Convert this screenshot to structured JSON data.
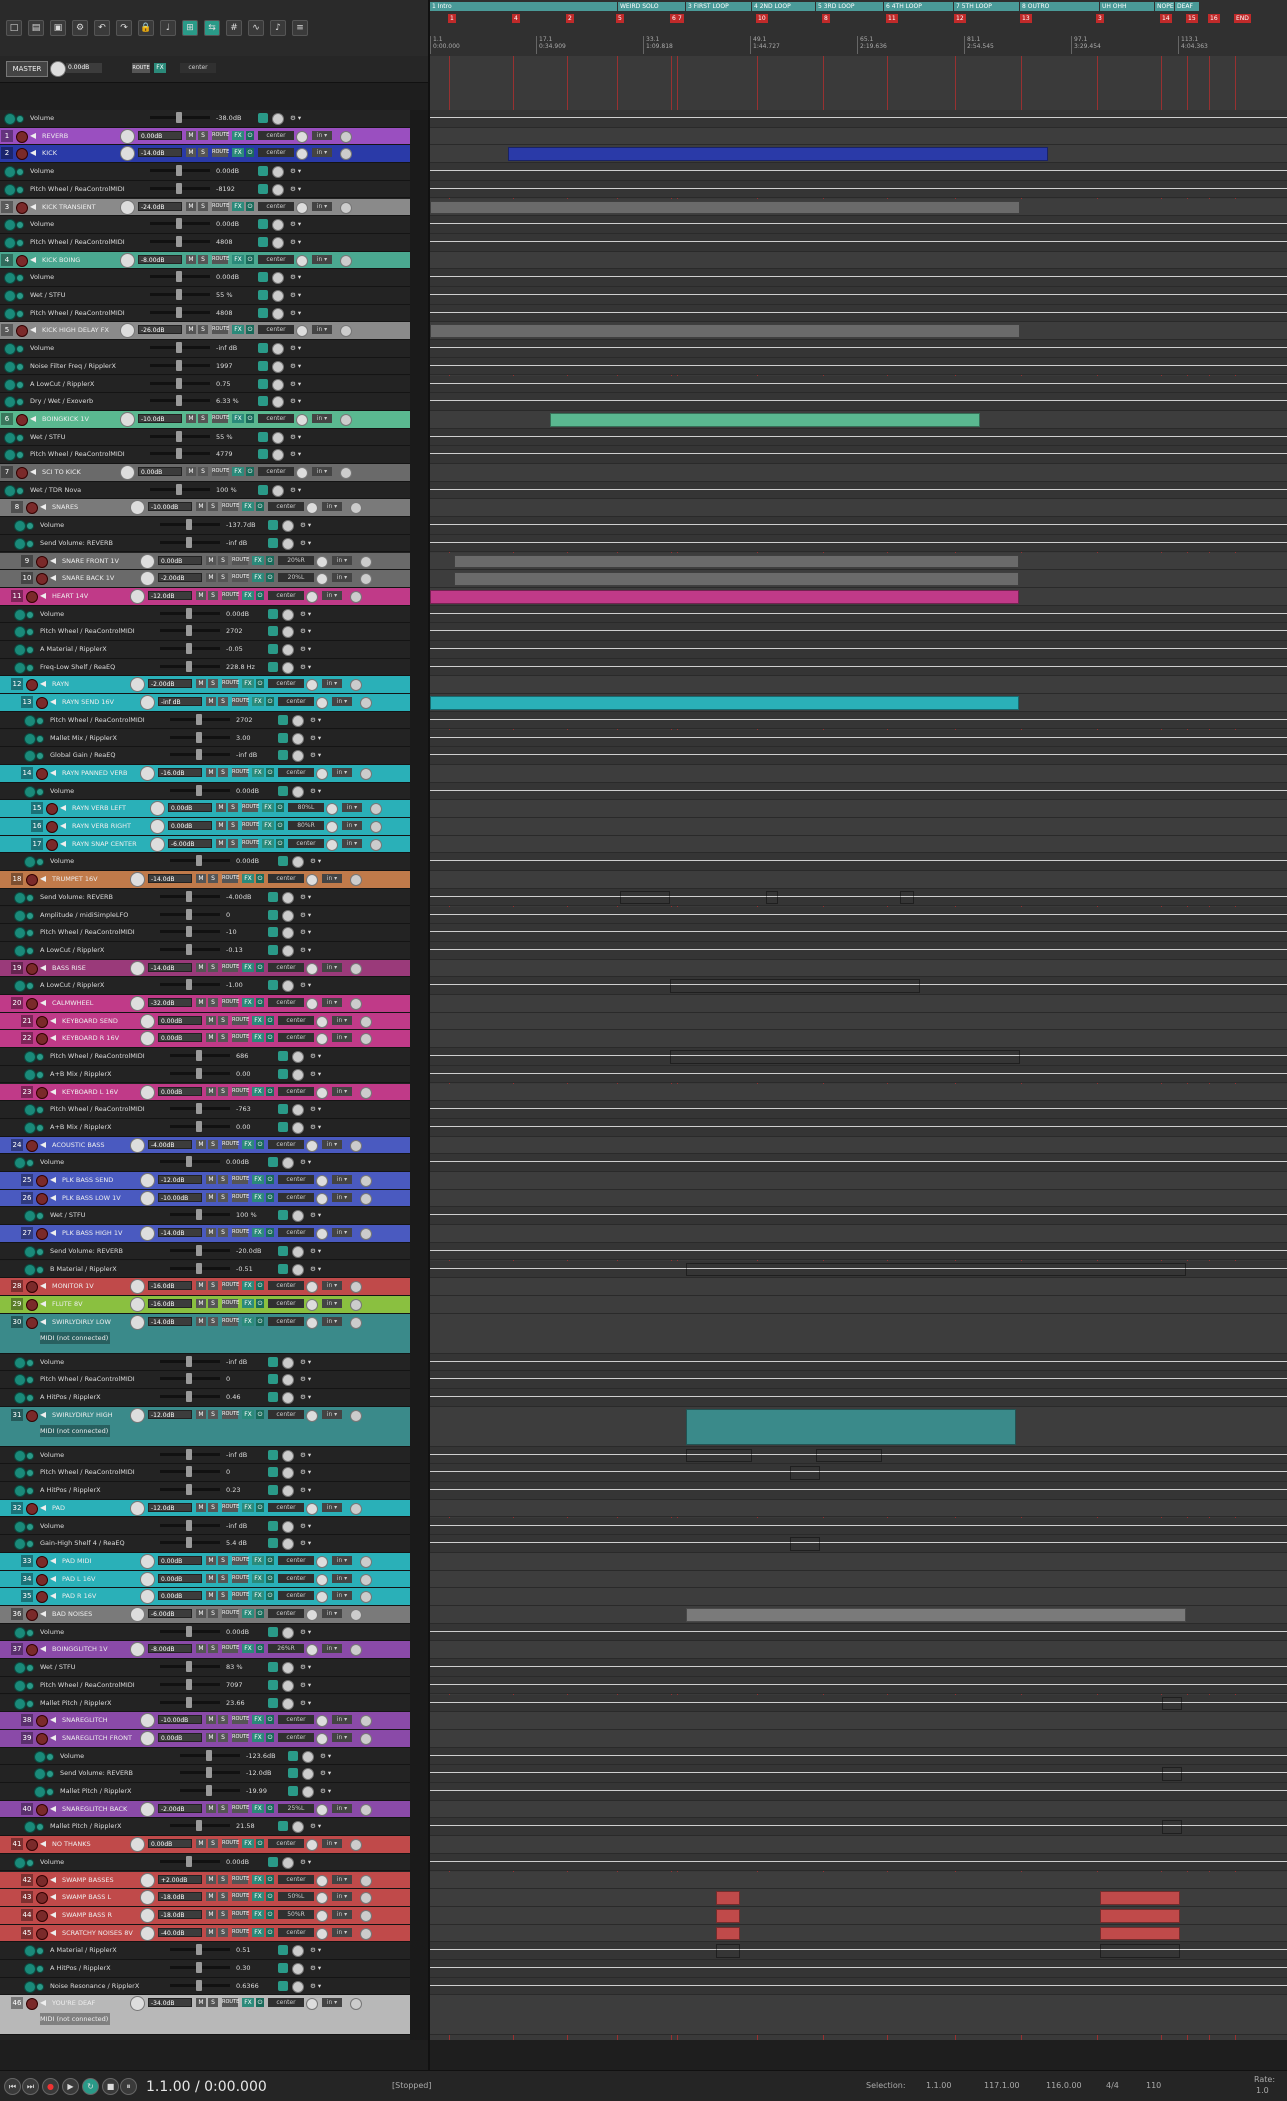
{
  "master": {
    "label": "MASTER",
    "volume": "0.00dB",
    "pan": "center",
    "route": "ROUTE",
    "fx": "FX"
  },
  "master_env": {
    "name": "Volume",
    "value": "-38.0dB"
  },
  "regions": [
    {
      "label": "1 Intro"
    },
    {
      "label": "WEIRD SOLO"
    },
    {
      "label": "3 FIRST LOOP"
    },
    {
      "label": "4 2ND LOOP"
    },
    {
      "label": "5 3RD LOOP"
    },
    {
      "label": "6 4TH LOOP"
    },
    {
      "label": "7 5TH LOOP"
    },
    {
      "label": "8 OUTRO"
    },
    {
      "label": "UH OHH"
    },
    {
      "label": "NOPE"
    },
    {
      "label": "DEAF"
    }
  ],
  "markers": [
    {
      "label": "1"
    },
    {
      "label": "4"
    },
    {
      "label": "2"
    },
    {
      "label": "5"
    },
    {
      "label": "6"
    },
    {
      "label": "7"
    },
    {
      "label": "10"
    },
    {
      "label": "8"
    },
    {
      "label": "11"
    },
    {
      "label": "12"
    },
    {
      "label": "13"
    },
    {
      "label": "3"
    },
    {
      "label": "14"
    },
    {
      "label": "15"
    },
    {
      "label": "16"
    },
    {
      "label": "END"
    }
  ],
  "ruler_ticks": [
    {
      "bar": "1.1",
      "time": "0:00.000"
    },
    {
      "bar": "17.1",
      "time": "0:34.909"
    },
    {
      "bar": "33.1",
      "time": "1:09.818"
    },
    {
      "bar": "49.1",
      "time": "1:44.727"
    },
    {
      "bar": "65.1",
      "time": "2:19.636"
    },
    {
      "bar": "81.1",
      "time": "2:54.545"
    },
    {
      "bar": "97.1",
      "time": "3:29.454"
    },
    {
      "bar": "113.1",
      "time": "4:04.363"
    }
  ],
  "tracks": [
    {
      "kind": "env",
      "indent": 0,
      "name": "Volume",
      "value": "-38.0dB"
    },
    {
      "kind": "track",
      "num": "1",
      "indent": 0,
      "name": "REVERB",
      "color": "#9a4fc0",
      "vol": "0.00dB",
      "pan": "center"
    },
    {
      "kind": "track",
      "num": "2",
      "indent": 0,
      "name": "KICK",
      "color": "#2a3aa8",
      "vol": "-14.0dB",
      "pan": "center"
    },
    {
      "kind": "env",
      "indent": 0,
      "name": "Volume",
      "value": "0.00dB"
    },
    {
      "kind": "env",
      "indent": 0,
      "name": "Pitch Wheel / ReaControlMIDI",
      "value": "-8192"
    },
    {
      "kind": "track",
      "num": "3",
      "indent": 0,
      "name": "KICK TRANSIENT",
      "color": "#8a8a8a",
      "vol": "-24.0dB",
      "pan": "center"
    },
    {
      "kind": "env",
      "indent": 0,
      "name": "Volume",
      "value": "0.00dB"
    },
    {
      "kind": "env",
      "indent": 0,
      "name": "Pitch Wheel / ReaControlMIDI",
      "value": "4808"
    },
    {
      "kind": "track",
      "num": "4",
      "indent": 0,
      "name": "KICK BOING",
      "color": "#4aa890",
      "vol": "-8.00dB",
      "pan": "center"
    },
    {
      "kind": "env",
      "indent": 0,
      "name": "Volume",
      "value": "0.00dB"
    },
    {
      "kind": "env",
      "indent": 0,
      "name": "Wet / STFU",
      "value": "55 %"
    },
    {
      "kind": "env",
      "indent": 0,
      "name": "Pitch Wheel / ReaControlMIDI",
      "value": "4808"
    },
    {
      "kind": "track",
      "num": "5",
      "indent": 0,
      "name": "KICK HIGH DELAY FX",
      "color": "#8a8a8a",
      "vol": "-26.0dB",
      "pan": "center"
    },
    {
      "kind": "env",
      "indent": 0,
      "name": "Volume",
      "value": "-inf dB"
    },
    {
      "kind": "env",
      "indent": 0,
      "name": "Noise Filter Freq / RipplerX",
      "value": "1997"
    },
    {
      "kind": "env",
      "indent": 0,
      "name": "A LowCut / RipplerX",
      "value": "0.75"
    },
    {
      "kind": "env",
      "indent": 0,
      "name": "Dry / Wet / Exoverb",
      "value": "6.33 %"
    },
    {
      "kind": "track",
      "num": "6",
      "indent": 0,
      "name": "BOINGKICK 1V",
      "color": "#5ab890",
      "vol": "-10.0dB",
      "pan": "center"
    },
    {
      "kind": "env",
      "indent": 0,
      "name": "Wet / STFU",
      "value": "55 %"
    },
    {
      "kind": "env",
      "indent": 0,
      "name": "Pitch Wheel / ReaControlMIDI",
      "value": "4779"
    },
    {
      "kind": "track",
      "num": "7",
      "indent": 0,
      "name": "SCI TO KICK",
      "color": "#6a6a6a",
      "vol": "0.00dB",
      "pan": "center"
    },
    {
      "kind": "env",
      "indent": 0,
      "name": "Wet / TDR Nova",
      "value": "100 %"
    },
    {
      "kind": "track",
      "num": "8",
      "indent": 1,
      "name": "SNARES",
      "color": "#7a7a7a",
      "vol": "-10.00dB",
      "pan": "center"
    },
    {
      "kind": "env",
      "indent": 1,
      "name": "Volume",
      "value": "-137.7dB"
    },
    {
      "kind": "env",
      "indent": 1,
      "name": "Send Volume: REVERB",
      "value": "-inf dB"
    },
    {
      "kind": "track",
      "num": "9",
      "indent": 2,
      "name": "SNARE FRONT 1V",
      "color": "#6a6a6a",
      "vol": "0.00dB",
      "pan": "20%R"
    },
    {
      "kind": "track",
      "num": "10",
      "indent": 2,
      "name": "SNARE BACK 1V",
      "color": "#6a6a6a",
      "vol": "-2.00dB",
      "pan": "20%L"
    },
    {
      "kind": "track",
      "num": "11",
      "indent": 1,
      "name": "HEART 14V",
      "color": "#c03a88",
      "vol": "-12.0dB",
      "pan": "center"
    },
    {
      "kind": "env",
      "indent": 1,
      "name": "Volume",
      "value": "0.00dB"
    },
    {
      "kind": "env",
      "indent": 1,
      "name": "Pitch Wheel / ReaControlMIDI",
      "value": "2702"
    },
    {
      "kind": "env",
      "indent": 1,
      "name": "A Material / RipplerX",
      "value": "-0.05"
    },
    {
      "kind": "env",
      "indent": 1,
      "name": "Freq-Low Shelf / ReaEQ",
      "value": "228.8 Hz"
    },
    {
      "kind": "track",
      "num": "12",
      "indent": 1,
      "name": "RAYN",
      "color": "#2ab0b8",
      "vol": "-2.00dB",
      "pan": "center"
    },
    {
      "kind": "track",
      "num": "13",
      "indent": 2,
      "name": "RAYN SEND 16V",
      "color": "#2ab0b8",
      "vol": "-inf dB",
      "pan": "center"
    },
    {
      "kind": "env",
      "indent": 2,
      "name": "Pitch Wheel / ReaControlMIDI",
      "value": "2702"
    },
    {
      "kind": "env",
      "indent": 2,
      "name": "Mallet Mix / RipplerX",
      "value": "3.00"
    },
    {
      "kind": "env",
      "indent": 2,
      "name": "Global Gain / ReaEQ",
      "value": "-inf dB"
    },
    {
      "kind": "track",
      "num": "14",
      "indent": 2,
      "name": "RAYN PANNED VERB",
      "color": "#2ab0b8",
      "vol": "-16.0dB",
      "pan": "center"
    },
    {
      "kind": "env",
      "indent": 2,
      "name": "Volume",
      "value": "0.00dB"
    },
    {
      "kind": "track",
      "num": "15",
      "indent": 3,
      "name": "RAYN VERB LEFT",
      "color": "#2ab0b8",
      "vol": "0.00dB",
      "pan": "80%L"
    },
    {
      "kind": "track",
      "num": "16",
      "indent": 3,
      "name": "RAYN VERB RIGHT",
      "color": "#2ab0b8",
      "vol": "0.00dB",
      "pan": "80%R"
    },
    {
      "kind": "track",
      "num": "17",
      "indent": 3,
      "name": "RAYN SNAP CENTER",
      "color": "#2ab0b8",
      "vol": "-6.00dB",
      "pan": "center"
    },
    {
      "kind": "env",
      "indent": 2,
      "name": "Volume",
      "value": "0.00dB"
    },
    {
      "kind": "track",
      "num": "18",
      "indent": 1,
      "name": "TRUMPET 16V",
      "color": "#c07a4a",
      "vol": "-14.0dB",
      "pan": "center"
    },
    {
      "kind": "env",
      "indent": 1,
      "name": "Send Volume: REVERB",
      "value": "-4.00dB"
    },
    {
      "kind": "env",
      "indent": 1,
      "name": "Amplitude / midiSimpleLFO",
      "value": "0"
    },
    {
      "kind": "env",
      "indent": 1,
      "name": "Pitch Wheel / ReaControlMIDI",
      "value": "-10"
    },
    {
      "kind": "env",
      "indent": 1,
      "name": "A LowCut / RipplerX",
      "value": "-0.13"
    },
    {
      "kind": "track",
      "num": "19",
      "indent": 1,
      "name": "BASS RISE",
      "color": "#9a3a7a",
      "vol": "-14.0dB",
      "pan": "center"
    },
    {
      "kind": "env",
      "indent": 1,
      "name": "A LowCut / RipplerX",
      "value": "-1.00"
    },
    {
      "kind": "track",
      "num": "20",
      "indent": 1,
      "name": "CALMWHEEL",
      "color": "#c03a88",
      "vol": "-32.0dB",
      "pan": "center"
    },
    {
      "kind": "track",
      "num": "21",
      "indent": 2,
      "name": "KEYBOARD SEND",
      "color": "#c03a88",
      "vol": "0.00dB",
      "pan": "center"
    },
    {
      "kind": "track",
      "num": "22",
      "indent": 2,
      "name": "KEYBOARD R 16V",
      "color": "#c03a88",
      "vol": "0.00dB",
      "pan": "center"
    },
    {
      "kind": "env",
      "indent": 2,
      "name": "Pitch Wheel / ReaControlMIDI",
      "value": "686"
    },
    {
      "kind": "env",
      "indent": 2,
      "name": "A+B Mix / RipplerX",
      "value": "0.00"
    },
    {
      "kind": "track",
      "num": "23",
      "indent": 2,
      "name": "KEYBOARD L 16V",
      "color": "#c03a88",
      "vol": "0.00dB",
      "pan": "center"
    },
    {
      "kind": "env",
      "indent": 2,
      "name": "Pitch Wheel / ReaControlMIDI",
      "value": "-763"
    },
    {
      "kind": "env",
      "indent": 2,
      "name": "A+B Mix / RipplerX",
      "value": "0.00"
    },
    {
      "kind": "track",
      "num": "24",
      "indent": 1,
      "name": "ACOUSTIC BASS",
      "color": "#4a5ac0",
      "vol": "-4.00dB",
      "pan": "center"
    },
    {
      "kind": "env",
      "indent": 1,
      "name": "Volume",
      "value": "0.00dB"
    },
    {
      "kind": "track",
      "num": "25",
      "indent": 2,
      "name": "PLK BASS SEND",
      "color": "#4a5ac0",
      "vol": "-12.0dB",
      "pan": "center"
    },
    {
      "kind": "track",
      "num": "26",
      "indent": 2,
      "name": "PLK BASS LOW 1V",
      "color": "#4a5ac0",
      "vol": "-10.00dB",
      "pan": "center"
    },
    {
      "kind": "env",
      "indent": 2,
      "name": "Wet / STFU",
      "value": "100 %"
    },
    {
      "kind": "track",
      "num": "27",
      "indent": 2,
      "name": "PLK BASS HIGH 1V",
      "color": "#4a5ac0",
      "vol": "-14.0dB",
      "pan": "center"
    },
    {
      "kind": "env",
      "indent": 2,
      "name": "Send Volume: REVERB",
      "value": "-20.0dB"
    },
    {
      "kind": "env",
      "indent": 2,
      "name": "B Material / RipplerX",
      "value": "-0.51"
    },
    {
      "kind": "track",
      "num": "28",
      "indent": 1,
      "name": "MONITOR 1V",
      "color": "#c04a4a",
      "vol": "-16.0dB",
      "pan": "center"
    },
    {
      "kind": "track",
      "num": "29",
      "indent": 1,
      "name": "FLUTE 8V",
      "color": "#8ac040",
      "vol": "-16.0dB",
      "pan": "center"
    },
    {
      "kind": "trackbig",
      "num": "30",
      "indent": 1,
      "name": "SWIRLYDIRLY LOW",
      "color": "#3a8a8a",
      "vol": "-14.0dB",
      "pan": "center",
      "midi": "MIDI (not connected)"
    },
    {
      "kind": "env",
      "indent": 1,
      "name": "Volume",
      "value": "-inf dB"
    },
    {
      "kind": "env",
      "indent": 1,
      "name": "Pitch Wheel / ReaControlMIDI",
      "value": "0"
    },
    {
      "kind": "env",
      "indent": 1,
      "name": "A HitPos / RipplerX",
      "value": "0.46"
    },
    {
      "kind": "trackbig",
      "num": "31",
      "indent": 1,
      "name": "SWIRLYDIRLY HIGH",
      "color": "#3a8a8a",
      "vol": "-12.0dB",
      "pan": "center",
      "midi": "MIDI (not connected)"
    },
    {
      "kind": "env",
      "indent": 1,
      "name": "Volume",
      "value": "-inf dB"
    },
    {
      "kind": "env",
      "indent": 1,
      "name": "Pitch Wheel / ReaControlMIDI",
      "value": "0"
    },
    {
      "kind": "env",
      "indent": 1,
      "name": "A HitPos / RipplerX",
      "value": "0.23"
    },
    {
      "kind": "track",
      "num": "32",
      "indent": 1,
      "name": "PAD",
      "color": "#2ab0b8",
      "vol": "-12.0dB",
      "pan": "center"
    },
    {
      "kind": "env",
      "indent": 1,
      "name": "Volume",
      "value": "-inf dB"
    },
    {
      "kind": "env",
      "indent": 1,
      "name": "Gain-High Shelf 4 / ReaEQ",
      "value": "5.4 dB"
    },
    {
      "kind": "track",
      "num": "33",
      "indent": 2,
      "name": "PAD MIDI",
      "color": "#2ab0b8",
      "vol": "0.00dB",
      "pan": "center"
    },
    {
      "kind": "track",
      "num": "34",
      "indent": 2,
      "name": "PAD L 16V",
      "color": "#2ab0b8",
      "vol": "0.00dB",
      "pan": "center"
    },
    {
      "kind": "track",
      "num": "35",
      "indent": 2,
      "name": "PAD R 16V",
      "color": "#2ab0b8",
      "vol": "0.00dB",
      "pan": "center"
    },
    {
      "kind": "track",
      "num": "36",
      "indent": 1,
      "name": "BAD NOISES",
      "color": "#7a7a7a",
      "vol": "-6.00dB",
      "pan": "center"
    },
    {
      "kind": "env",
      "indent": 1,
      "name": "Volume",
      "value": "0.00dB"
    },
    {
      "kind": "track",
      "num": "37",
      "indent": 1,
      "name": "BOINGGLITCH 1V",
      "color": "#8a4aa8",
      "vol": "-8.00dB",
      "pan": "26%R"
    },
    {
      "kind": "env",
      "indent": 1,
      "name": "Wet / STFU",
      "value": "83 %"
    },
    {
      "kind": "env",
      "indent": 1,
      "name": "Pitch Wheel / ReaControlMIDI",
      "value": "7097"
    },
    {
      "kind": "env",
      "indent": 1,
      "name": "Mallet Pitch / RipplerX",
      "value": "23.66"
    },
    {
      "kind": "track",
      "num": "38",
      "indent": 2,
      "name": "SNAREGLITCH",
      "color": "#8a4aa8",
      "vol": "-10.00dB",
      "pan": "center"
    },
    {
      "kind": "track",
      "num": "39",
      "indent": 2,
      "name": "SNAREGLITCH FRONT",
      "color": "#8a4aa8",
      "vol": "0.00dB",
      "pan": "center"
    },
    {
      "kind": "env",
      "indent": 3,
      "name": "Volume",
      "value": "-123.6dB"
    },
    {
      "kind": "env",
      "indent": 3,
      "name": "Send Volume: REVERB",
      "value": "-12.0dB"
    },
    {
      "kind": "env",
      "indent": 3,
      "name": "Mallet Pitch / RipplerX",
      "value": "-19.99"
    },
    {
      "kind": "track",
      "num": "40",
      "indent": 2,
      "name": "SNAREGLITCH BACK",
      "color": "#8a4aa8",
      "vol": "-2.00dB",
      "pan": "25%L"
    },
    {
      "kind": "env",
      "indent": 2,
      "name": "Mallet Pitch / RipplerX",
      "value": "21.58"
    },
    {
      "kind": "track",
      "num": "41",
      "indent": 1,
      "name": "NO THANKS",
      "color": "#c04a4a",
      "vol": "0.00dB",
      "pan": "center"
    },
    {
      "kind": "env",
      "indent": 1,
      "name": "Volume",
      "value": "0.00dB"
    },
    {
      "kind": "track",
      "num": "42",
      "indent": 2,
      "name": "SWAMP BASSES",
      "color": "#c04a4a",
      "vol": "+2.00dB",
      "pan": "center"
    },
    {
      "kind": "track",
      "num": "43",
      "indent": 2,
      "name": "SWAMP BASS L",
      "color": "#c04a4a",
      "vol": "-18.0dB",
      "pan": "50%L"
    },
    {
      "kind": "track",
      "num": "44",
      "indent": 2,
      "name": "SWAMP BASS R",
      "color": "#c04a4a",
      "vol": "-18.0dB",
      "pan": "50%R"
    },
    {
      "kind": "track",
      "num": "45",
      "indent": 2,
      "name": "SCRATCHY NOISES 8V",
      "color": "#c04a4a",
      "vol": "-40.0dB",
      "pan": "center"
    },
    {
      "kind": "env",
      "indent": 2,
      "name": "A Material / RipplerX",
      "value": "0.51"
    },
    {
      "kind": "env",
      "indent": 2,
      "name": "A HitPos / RipplerX",
      "value": "0.30"
    },
    {
      "kind": "env",
      "indent": 2,
      "name": "Noise Resonance / RipplerX",
      "value": "0.6366"
    },
    {
      "kind": "trackbig",
      "num": "46",
      "indent": 1,
      "name": "YOU'RE DEAF",
      "color": "#b8b8b8",
      "vol": "-34.0dB",
      "pan": "center",
      "midi": "MIDI (not connected)"
    }
  ],
  "transport": {
    "position": "1.1.00 / 0:00.000",
    "status": "[Stopped]",
    "selection_label": "Selection:",
    "sel_start": "1.1.00",
    "sel_end": "117.1.00",
    "sel_len": "116.0.00",
    "timesig": "4/4",
    "bpm": "110",
    "rate_label": "Rate:",
    "rate": "1.0"
  },
  "colors": {
    "accent": "#2ab0b8",
    "marker": "#c02a2a",
    "region": "#4a9a98"
  }
}
